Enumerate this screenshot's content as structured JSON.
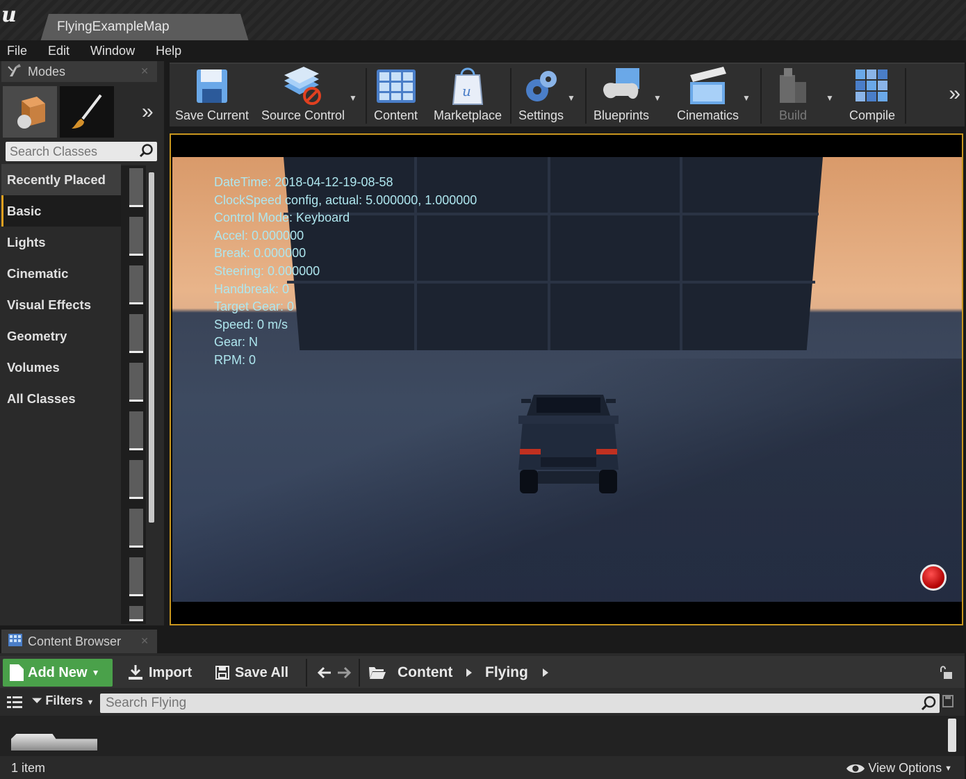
{
  "document_tab": "FlyingExampleMap",
  "menu": [
    "File",
    "Edit",
    "Window",
    "Help"
  ],
  "modes": {
    "tab_label": "Modes",
    "search_placeholder": "Search Classes",
    "categories": [
      "Recently Placed",
      "Basic",
      "Lights",
      "Cinematic",
      "Visual Effects",
      "Geometry",
      "Volumes",
      "All Classes"
    ],
    "active_category": "Basic"
  },
  "toolbar": {
    "save_current": "Save Current",
    "source_control": "Source Control",
    "content": "Content",
    "marketplace": "Marketplace",
    "settings": "Settings",
    "blueprints": "Blueprints",
    "cinematics": "Cinematics",
    "build": "Build",
    "compile": "Compile"
  },
  "hud": {
    "lines": [
      "DateTime: 2018-04-12-19-08-58",
      "ClockSpeed config, actual: 5.000000, 1.000000",
      "Control Mode: Keyboard",
      "Accel: 0.000000",
      "Break: 0.000000",
      "Steering: 0.000000",
      "Handbreak: 0",
      "Target Gear: 0",
      "Speed: 0 m/s",
      "Gear: N",
      "RPM: 0"
    ]
  },
  "content_browser": {
    "tab_label": "Content Browser",
    "add_new": "Add New",
    "import": "Import",
    "save_all": "Save All",
    "breadcrumb": [
      "Content",
      "Flying"
    ],
    "filters": "Filters",
    "search_placeholder": "Search Flying",
    "item_count": "1 item",
    "view_options": "View Options"
  },
  "colors": {
    "accent_orange": "#c8961e",
    "add_new_green": "#4aa14a",
    "hud_text": "#aee6ee"
  }
}
